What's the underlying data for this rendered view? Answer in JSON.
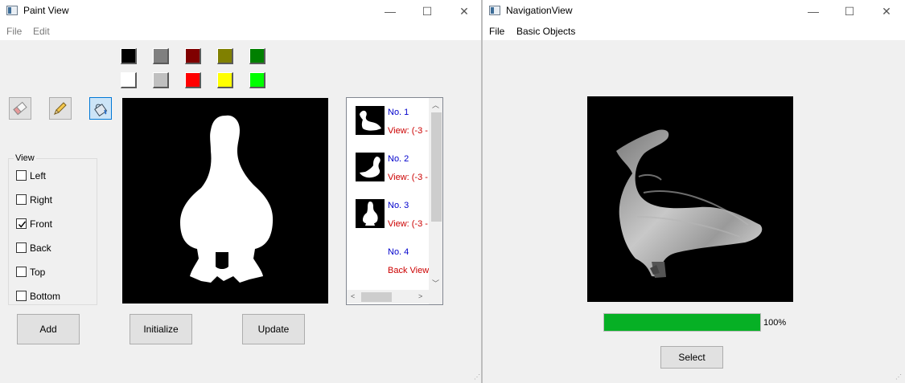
{
  "paint_window": {
    "title": "Paint View",
    "controls": {
      "minimize": "—",
      "maximize": "☐",
      "close": "✕"
    },
    "menu": [
      "File",
      "Edit"
    ],
    "palette": [
      "#000000",
      "#808080",
      "#800000",
      "#808000",
      "#008000",
      "#ffffff",
      "#c0c0c0",
      "#ff0000",
      "#ffff00",
      "#00ff00"
    ],
    "tools": [
      "eraser-icon",
      "pencil-icon",
      "paint-bucket-icon"
    ],
    "active_tool": "paint-bucket-icon",
    "view_group": {
      "title": "View",
      "options": [
        {
          "label": "Left",
          "checked": false
        },
        {
          "label": "Right",
          "checked": false
        },
        {
          "label": "Front",
          "checked": true
        },
        {
          "label": "Back",
          "checked": false
        },
        {
          "label": "Top",
          "checked": false
        },
        {
          "label": "Bottom",
          "checked": false
        }
      ]
    },
    "buttons": {
      "add": "Add",
      "initialize": "Initialize",
      "update": "Update"
    },
    "list_items": [
      {
        "no": "No. 1",
        "view": "View: (-3 -",
        "has_thumb": true
      },
      {
        "no": "No. 2",
        "view": "View: (-3 -",
        "has_thumb": true
      },
      {
        "no": "No. 3",
        "view": "View: (-3 -",
        "has_thumb": true
      },
      {
        "no": "No. 4",
        "view": "Back View:",
        "has_thumb": false
      }
    ]
  },
  "nav_window": {
    "title": "NavigationView",
    "controls": {
      "minimize": "—",
      "maximize": "☐",
      "close": "✕"
    },
    "menu": [
      "File",
      "Basic Objects"
    ],
    "progress": {
      "value": 100,
      "label": "100%"
    },
    "select_button": "Select"
  }
}
